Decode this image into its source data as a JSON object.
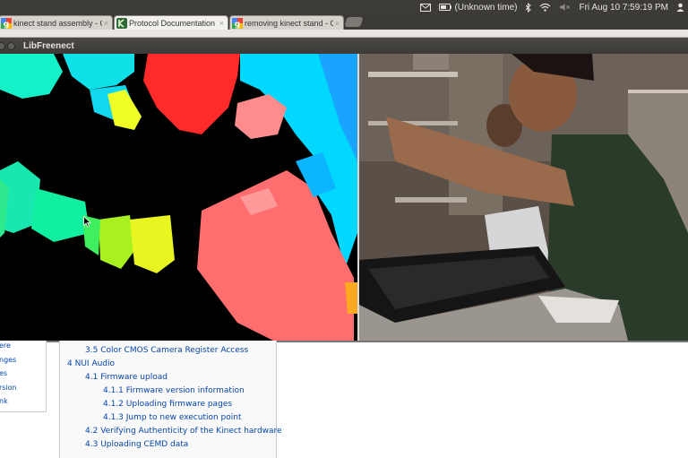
{
  "system_panel": {
    "status_text": "(Unknown time)",
    "clock": "Fri Aug 10  7:59:19 PM",
    "icons": [
      "mail-icon",
      "battery-icon",
      "bluetooth-icon",
      "wifi-icon",
      "volume-icon",
      "user-icon"
    ]
  },
  "browser": {
    "tabs": [
      {
        "title": "kinect stand assembly - Go",
        "favicon": "google-icon",
        "active": false
      },
      {
        "title": "Protocol Documentation",
        "favicon": "openkinect-icon",
        "active": true
      },
      {
        "title": "removing kinect stand - Go",
        "favicon": "google-icon",
        "active": false
      }
    ],
    "close_glyph": "×"
  },
  "window": {
    "title": "LibFreenect",
    "panes": [
      "depth-view",
      "rgb-camera-view"
    ]
  },
  "wiki": {
    "sidebar_items": [
      "ere",
      "nges",
      "es",
      "rsion",
      "nk"
    ],
    "toc": [
      {
        "number": "3.5",
        "label": "Color CMOS Camera Register Access",
        "level": 2
      },
      {
        "number": "4",
        "label": "NUI Audio",
        "level": 1
      },
      {
        "number": "4.1",
        "label": "Firmware upload",
        "level": 2
      },
      {
        "number": "4.1.1",
        "label": "Firmware version information",
        "level": 3
      },
      {
        "number": "4.1.2",
        "label": "Uploading firmware pages",
        "level": 3
      },
      {
        "number": "4.1.3",
        "label": "Jump to new execution point",
        "level": 3
      },
      {
        "number": "4.2",
        "label": "Verifying Authenticity of the Kinect hardware",
        "level": 2
      },
      {
        "number": "4.3",
        "label": "Uploading CEMD data",
        "level": 2
      }
    ]
  },
  "colors": {
    "panel_bg": "#3c3b37",
    "link": "#0645ad",
    "depth_near": "#ff3b2f",
    "depth_mid": "#f7f72a",
    "depth_far": "#00e5ff"
  }
}
